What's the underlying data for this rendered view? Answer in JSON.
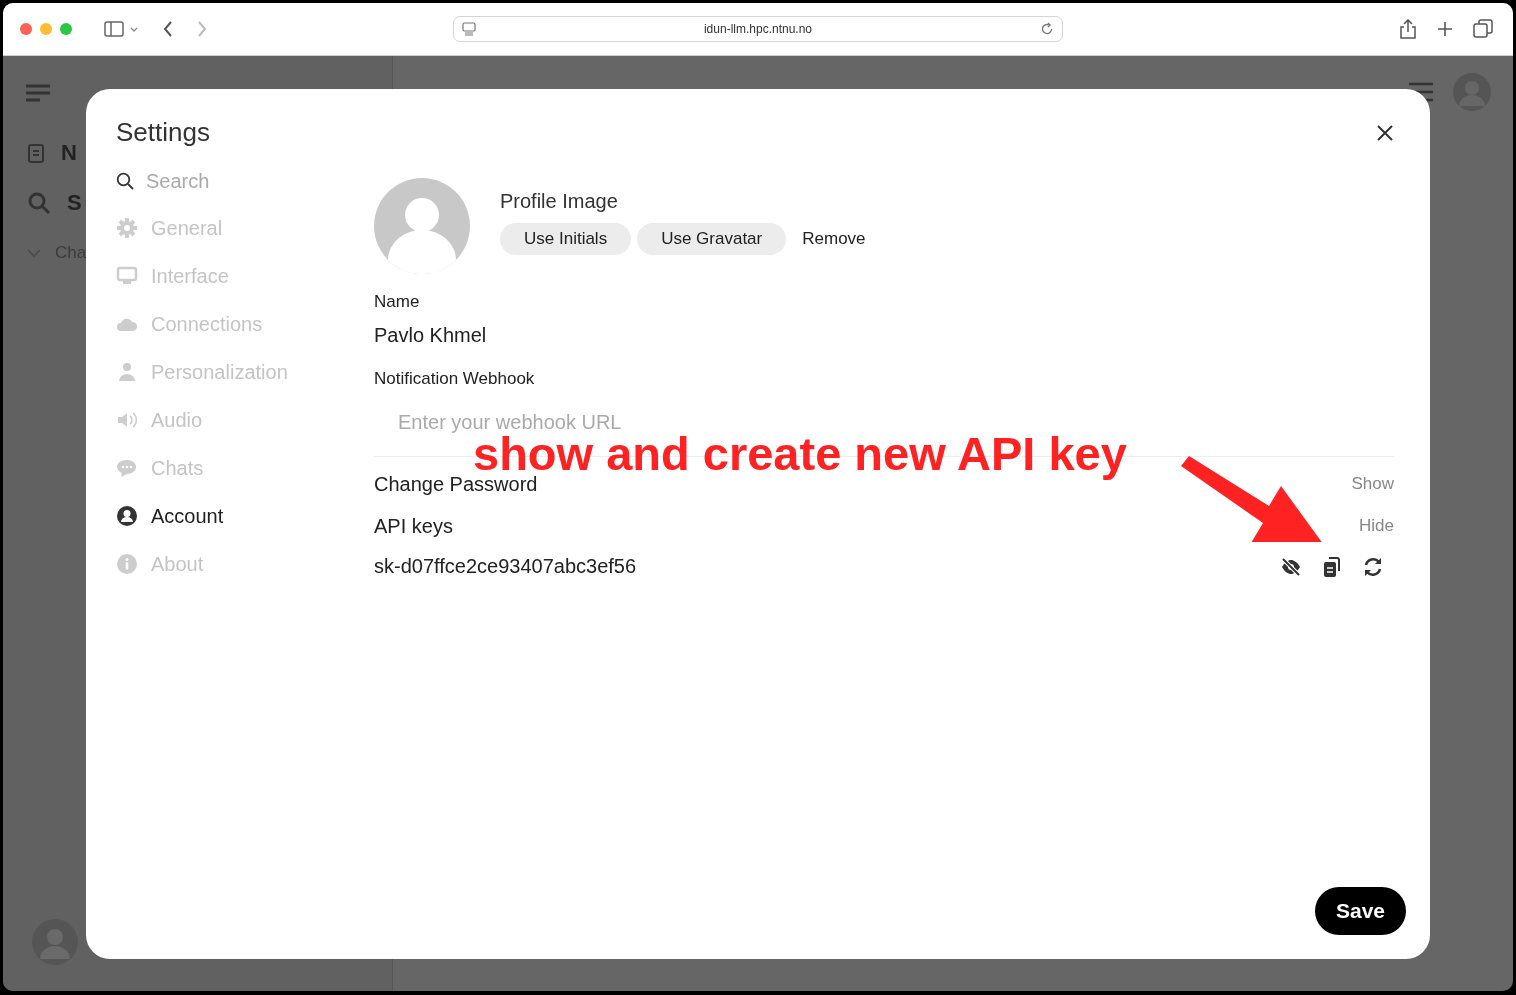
{
  "browser": {
    "url": "idun-llm.hpc.ntnu.no"
  },
  "background_sidebar": {
    "items": [
      {
        "label": "N"
      },
      {
        "label": "S"
      },
      {
        "label": "Cha"
      }
    ]
  },
  "settings": {
    "title": "Settings",
    "search": {
      "placeholder": "Search"
    },
    "nav": [
      {
        "label": "General",
        "selected": false
      },
      {
        "label": "Interface",
        "selected": false
      },
      {
        "label": "Connections",
        "selected": false
      },
      {
        "label": "Personalization",
        "selected": false
      },
      {
        "label": "Audio",
        "selected": false
      },
      {
        "label": "Chats",
        "selected": false
      },
      {
        "label": "Account",
        "selected": true
      },
      {
        "label": "About",
        "selected": false
      }
    ],
    "profile": {
      "heading": "Profile Image",
      "buttons": [
        "Use Initials",
        "Use Gravatar"
      ],
      "remove": "Remove"
    },
    "name": {
      "label": "Name",
      "value": "Pavlo Khmel"
    },
    "webhook": {
      "label": "Notification Webhook",
      "placeholder": "Enter your webhook URL"
    },
    "change_password": {
      "label": "Change Password",
      "toggle": "Show"
    },
    "api_keys": {
      "label": "API keys",
      "toggle": "Hide",
      "key": "sk-d07ffce2ce93407abc3ef56"
    },
    "save": "Save"
  },
  "annotation": {
    "text": "show and create new API key"
  }
}
